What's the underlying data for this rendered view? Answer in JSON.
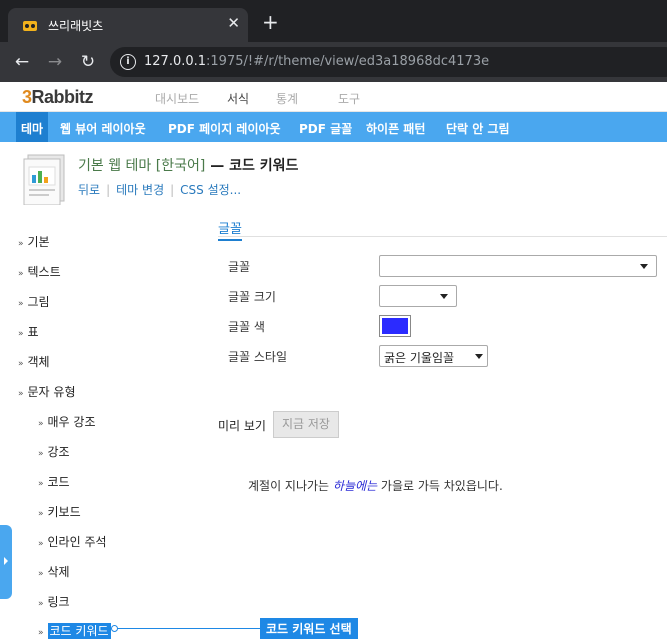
{
  "browser": {
    "tab_title": "쓰리래빗츠",
    "url_host": "127.0.0.1",
    "url_rest": ":1975/!#/r/theme/view/ed3a18968dc4173e"
  },
  "app": {
    "logo_digit": "3",
    "logo_text": "Rabbitz",
    "top_menu": [
      "대시보드",
      "서식",
      "통계",
      "도구"
    ],
    "sub_menu": [
      "테마",
      "웹 뷰어 레이아웃",
      "PDF 페이지 레이아웃",
      "PDF 글꼴",
      "하이픈 패턴",
      "단락 안 그림"
    ]
  },
  "theme": {
    "name": "기본 웹 테마 [한국어]",
    "dash": " — ",
    "current": "코드 키워드",
    "links": [
      "뒤로",
      "테마 변경",
      "CSS 설정..."
    ]
  },
  "sidebar": {
    "items": [
      "기본",
      "텍스트",
      "그림",
      "표",
      "객체",
      "문자 유형"
    ],
    "subitems": [
      "매우 강조",
      "강조",
      "코드",
      "키보드",
      "인라인 주석",
      "삭제",
      "링크",
      "코드 키워드"
    ]
  },
  "font_section": {
    "title": "글꼴",
    "font_label": "글꼴",
    "font_value": "",
    "size_label": "글꼴 크기",
    "size_value": "",
    "color_label": "글꼴 색",
    "color_value": "#2b2bff",
    "style_label": "글꼴 스타일",
    "style_value": "굵은 기울임꼴"
  },
  "preview": {
    "label": "미리 보기",
    "save_button": "지금 저장",
    "sample_before": "계절이 지나가는 ",
    "sample_keyword": "하늘에는",
    "sample_after": " 가을로 가득 차있읍니다."
  },
  "annotation": {
    "label": "코드 키워드 선택"
  }
}
